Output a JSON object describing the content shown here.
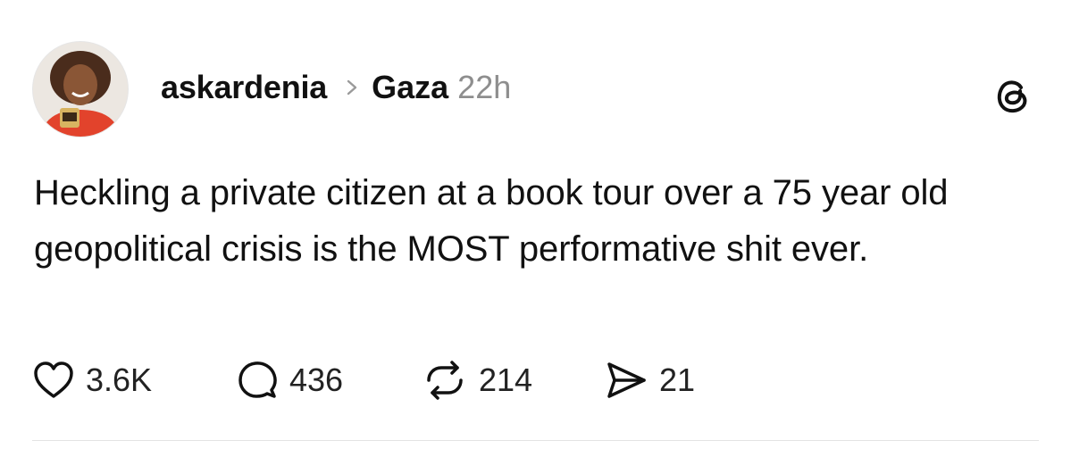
{
  "post": {
    "author": {
      "username": "askardenia",
      "avatar_icon": "profile-photo-avatar"
    },
    "topic": "Gaza",
    "timestamp": "22h",
    "breadcrumb_icon": "chevron-right-icon",
    "app_icon": "threads-logo-icon",
    "text": "Heckling a private citizen at a book tour over a 75 year old geopolitical crisis is the MOST performative shit ever.",
    "actions": {
      "like": {
        "icon": "heart-icon",
        "count": "3.6K"
      },
      "reply": {
        "icon": "comment-bubble-icon",
        "count": "436"
      },
      "repost": {
        "icon": "repost-icon",
        "count": "214"
      },
      "share": {
        "icon": "send-icon",
        "count": "21"
      }
    }
  },
  "colors": {
    "text": "#111111",
    "muted": "#8e8e8e",
    "divider": "#e3e3e3",
    "background": "#ffffff"
  }
}
